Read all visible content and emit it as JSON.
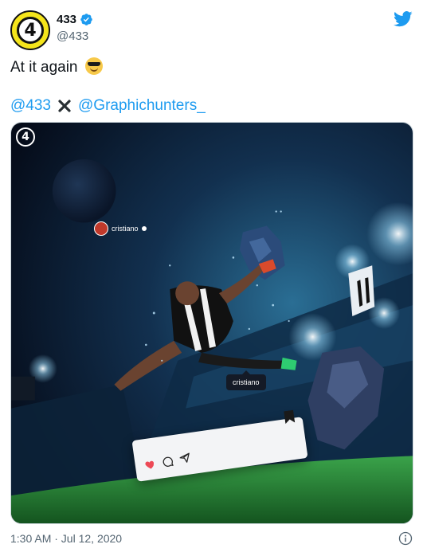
{
  "header": {
    "display_name": "433",
    "handle": "@433",
    "avatar_glyph": "4",
    "verified_icon": "verified-badge-icon",
    "platform_icon": "twitter-bird-icon"
  },
  "tweet": {
    "text": "At it again",
    "emoji_icon": "sunglasses-emoji-icon",
    "mentions": [
      "@433",
      "@Graphichunters_"
    ],
    "separator_icon": "cross-mark-icon"
  },
  "media": {
    "watermark_glyph": "4",
    "tag_top_label": "cristiano",
    "tag_bubble_label": "cristiano"
  },
  "footer": {
    "timestamp": "1:30 AM · Jul 12, 2020",
    "info_icon": "info-icon"
  },
  "colors": {
    "link": "#1d9bf0",
    "verified": "#1d9bf0",
    "avatar_bg": "#f5e51b",
    "muted_text": "#536471",
    "heart": "#ed4956"
  }
}
